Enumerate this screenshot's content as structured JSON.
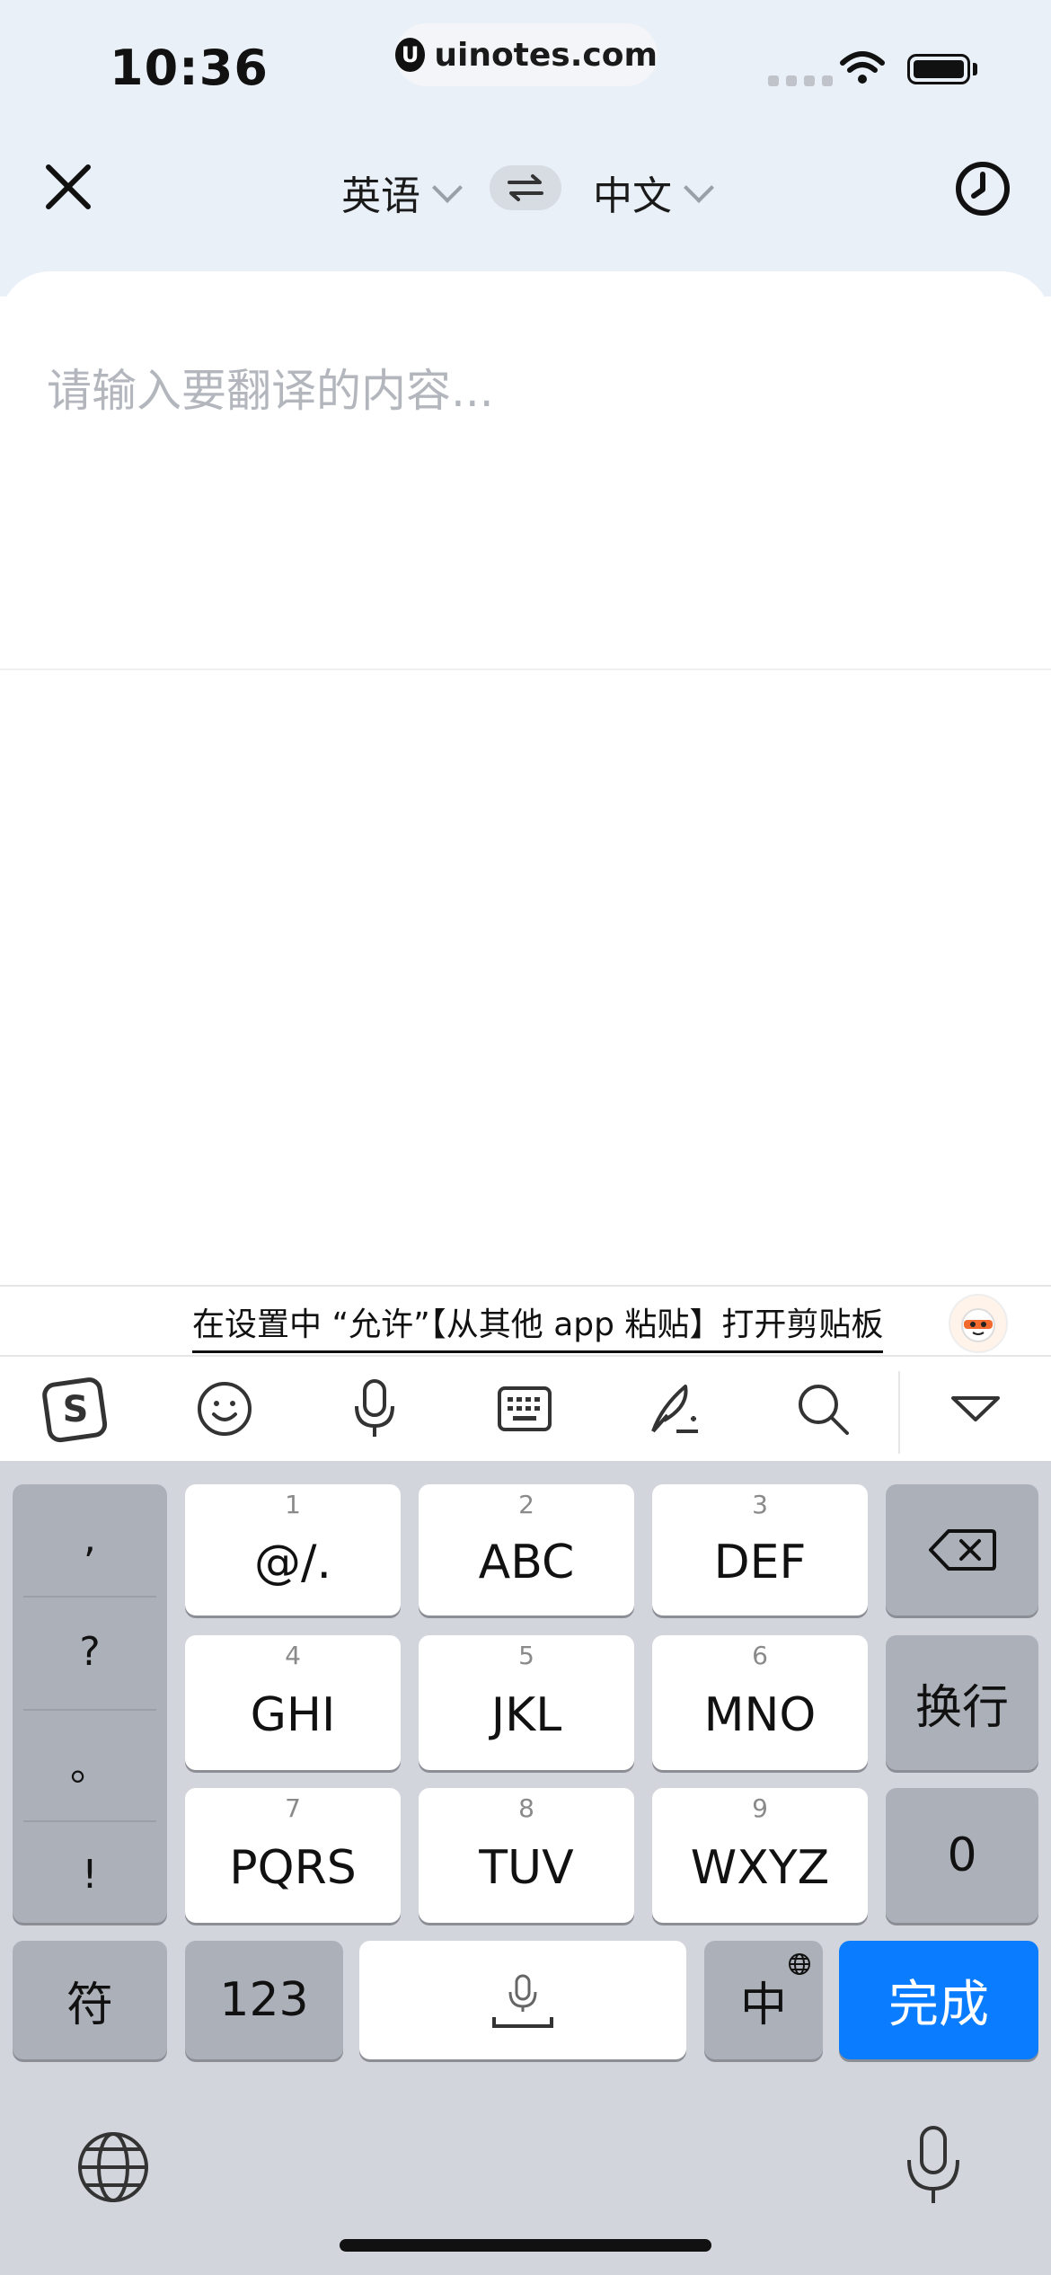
{
  "status_bar": {
    "time": "10:36",
    "url": "uinotes.com",
    "url_logo": "U"
  },
  "header": {
    "close_icon": "close-icon",
    "source_lang": "英语",
    "target_lang": "中文",
    "swap_icon": "swap-icon",
    "history_icon": "clock-icon"
  },
  "input": {
    "placeholder": "请输入要翻译的内容..."
  },
  "clipboard_hint": {
    "text": "在设置中 “允许”【从其他 app 粘贴】打开剪贴板"
  },
  "keyboard_toolbar": {
    "items": [
      "sogou-logo-icon",
      "emoji-icon",
      "microphone-icon",
      "keyboard-icon",
      "pen-icon",
      "search-icon",
      "collapse-icon"
    ]
  },
  "keyboard": {
    "punctuation": [
      ",",
      "?",
      "。",
      "!"
    ],
    "keys": [
      {
        "num": "1",
        "label": "@/."
      },
      {
        "num": "2",
        "label": "ABC"
      },
      {
        "num": "3",
        "label": "DEF"
      },
      {
        "num": "4",
        "label": "GHI"
      },
      {
        "num": "5",
        "label": "JKL"
      },
      {
        "num": "6",
        "label": "MNO"
      },
      {
        "num": "7",
        "label": "PQRS"
      },
      {
        "num": "8",
        "label": "TUV"
      },
      {
        "num": "9",
        "label": "WXYZ"
      }
    ],
    "newline_label": "换行",
    "zero_label": "0",
    "symbols_label": "符",
    "numbers_label": "123",
    "lang_label": "中",
    "done_label": "完成",
    "accent_color": "#0A7CFF"
  }
}
